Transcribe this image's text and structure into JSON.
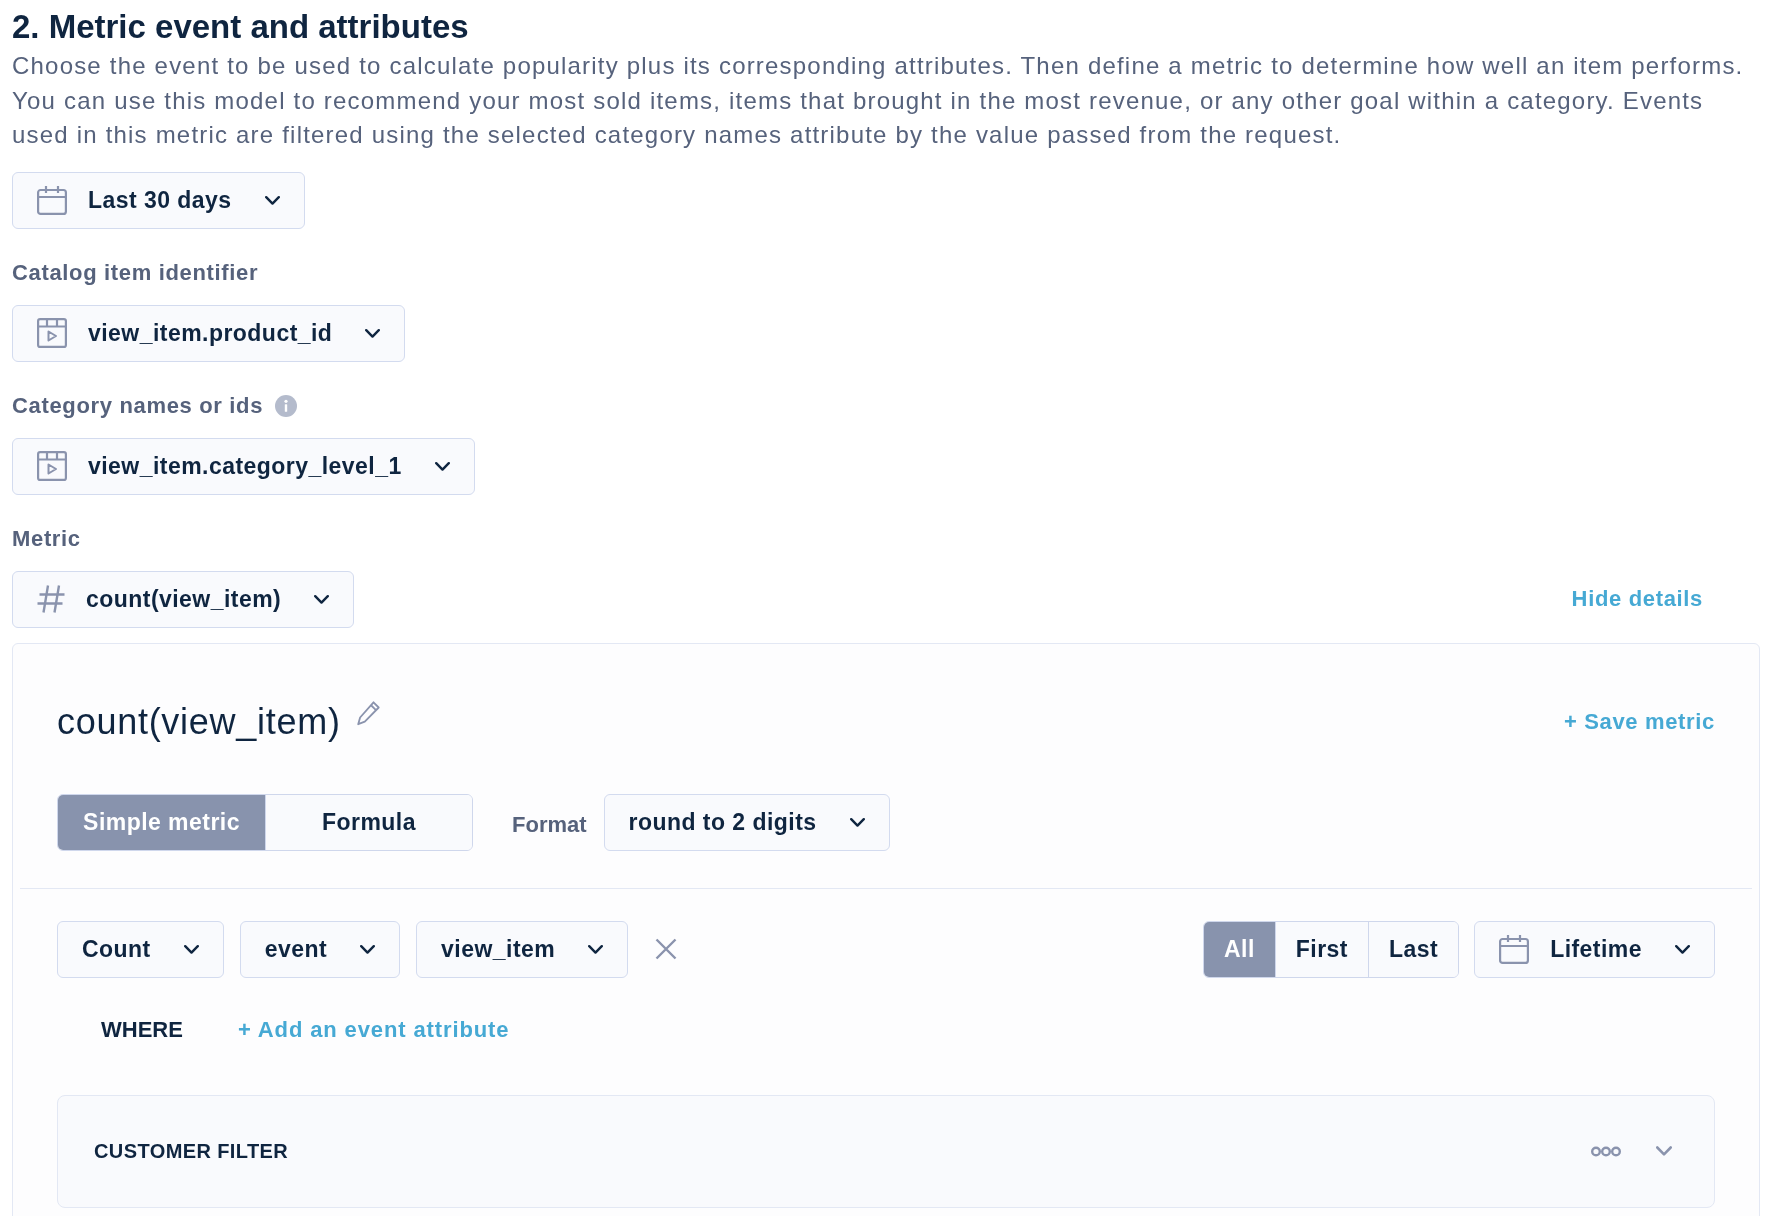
{
  "section": {
    "title": "2. Metric event and attributes",
    "description": "Choose the event to be used to calculate popularity plus its corresponding attributes. Then define a metric to determine how well an item performs. You can use this model to recommend your most sold items, items that brought in the most revenue, or any other goal within a category. Events used in this metric are filtered using the selected category names attribute by the value passed from the request."
  },
  "selectors": [
    {
      "kind": "date",
      "info": false,
      "value": "Last 30 days"
    },
    {
      "kind": "attribute",
      "label": "Catalog item identifier",
      "info": false,
      "value": "view_item.product_id"
    },
    {
      "kind": "attribute",
      "label": "Category names or ids",
      "info": true,
      "value": "view_item.category_level_1"
    },
    {
      "kind": "metric",
      "label": "Metric",
      "info": false,
      "value": "count(view_item)",
      "toggle_link": "Hide details"
    }
  ],
  "metric_panel": {
    "title": "count(view_item)",
    "save_link": "+ Save metric",
    "modes": [
      {
        "label": "Simple metric",
        "selected": true
      },
      {
        "label": "Formula",
        "selected": false
      }
    ],
    "format": {
      "label": "Format",
      "value": "round to 2 digits"
    },
    "query": [
      "Count",
      "event",
      "view_item"
    ],
    "occurrences": [
      {
        "label": "All",
        "selected": true
      },
      {
        "label": "First",
        "selected": false
      },
      {
        "label": "Last",
        "selected": false
      }
    ],
    "time_range": "Lifetime",
    "where": {
      "label": "WHERE",
      "add_link": "+ Add an event attribute"
    },
    "customer_filter": {
      "title": "CUSTOMER FILTER",
      "expanded": false
    }
  }
}
